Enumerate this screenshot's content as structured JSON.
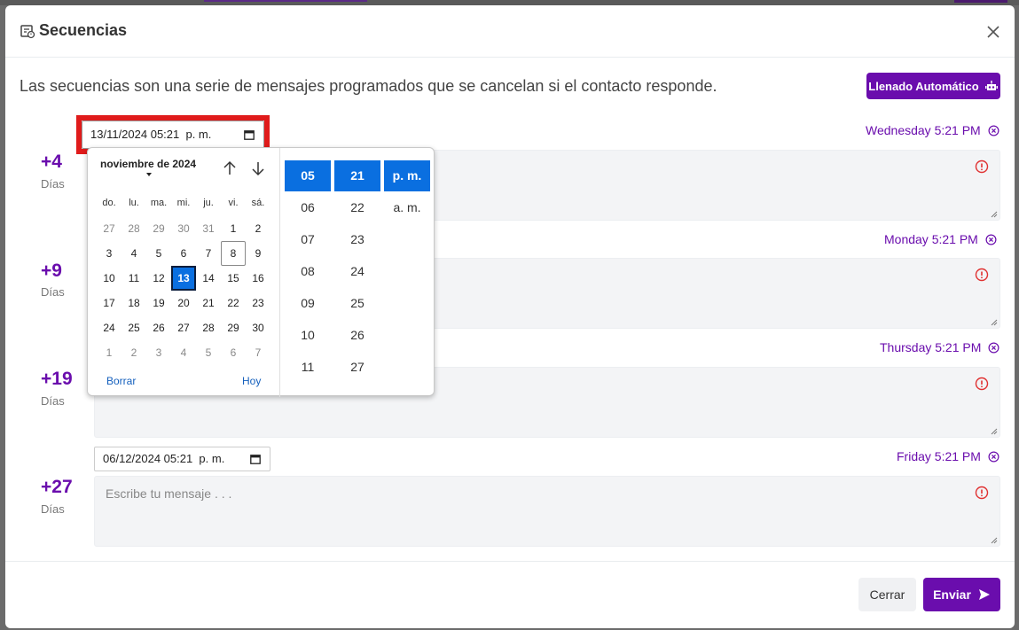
{
  "modal": {
    "title": "Secuencias",
    "description": "Las secuencias son una serie de mensajes programados que se cancelan si el contacto responde.",
    "auto_fill_label": "Llenado Automático"
  },
  "steps": [
    {
      "offset": "+4",
      "unit": "Días",
      "schedule": "Wednesday 5:21 PM"
    },
    {
      "offset": "+9",
      "unit": "Días",
      "schedule": "Monday 5:21 PM"
    },
    {
      "offset": "+19",
      "unit": "Días",
      "schedule": "Thursday 5:21 PM"
    },
    {
      "offset": "+27",
      "unit": "Días",
      "schedule": "Friday 5:21 PM",
      "date_value": "06/12/2024 05:21  p. m.",
      "message_placeholder": "Escribe tu mensaje . . ."
    }
  ],
  "active_date_input": {
    "value": "13/11/2024 05:21  p. m."
  },
  "datepicker": {
    "month_label": "noviembre de 2024",
    "weekdays": [
      "do.",
      "lu.",
      "ma.",
      "mi.",
      "ju.",
      "vi.",
      "sá."
    ],
    "weeks": [
      [
        "27",
        "28",
        "29",
        "30",
        "31",
        "1",
        "2"
      ],
      [
        "3",
        "4",
        "5",
        "6",
        "7",
        "8",
        "9"
      ],
      [
        "10",
        "11",
        "12",
        "13",
        "14",
        "15",
        "16"
      ],
      [
        "17",
        "18",
        "19",
        "20",
        "21",
        "22",
        "23"
      ],
      [
        "24",
        "25",
        "26",
        "27",
        "28",
        "29",
        "30"
      ],
      [
        "1",
        "2",
        "3",
        "4",
        "5",
        "6",
        "7"
      ]
    ],
    "selected_day": "13",
    "today_day": "8",
    "clear_label": "Borrar",
    "today_label": "Hoy",
    "hours": [
      "05",
      "06",
      "07",
      "08",
      "09",
      "10",
      "11"
    ],
    "minutes": [
      "21",
      "22",
      "23",
      "24",
      "25",
      "26",
      "27"
    ],
    "meridiems": [
      "p. m.",
      "a. m."
    ]
  },
  "footer": {
    "close_label": "Cerrar",
    "send_label": "Enviar"
  },
  "colors": {
    "accent": "#6a0dad",
    "selection": "#0a6fe0",
    "warning": "#e03131",
    "highlight": "#e01b1b"
  }
}
